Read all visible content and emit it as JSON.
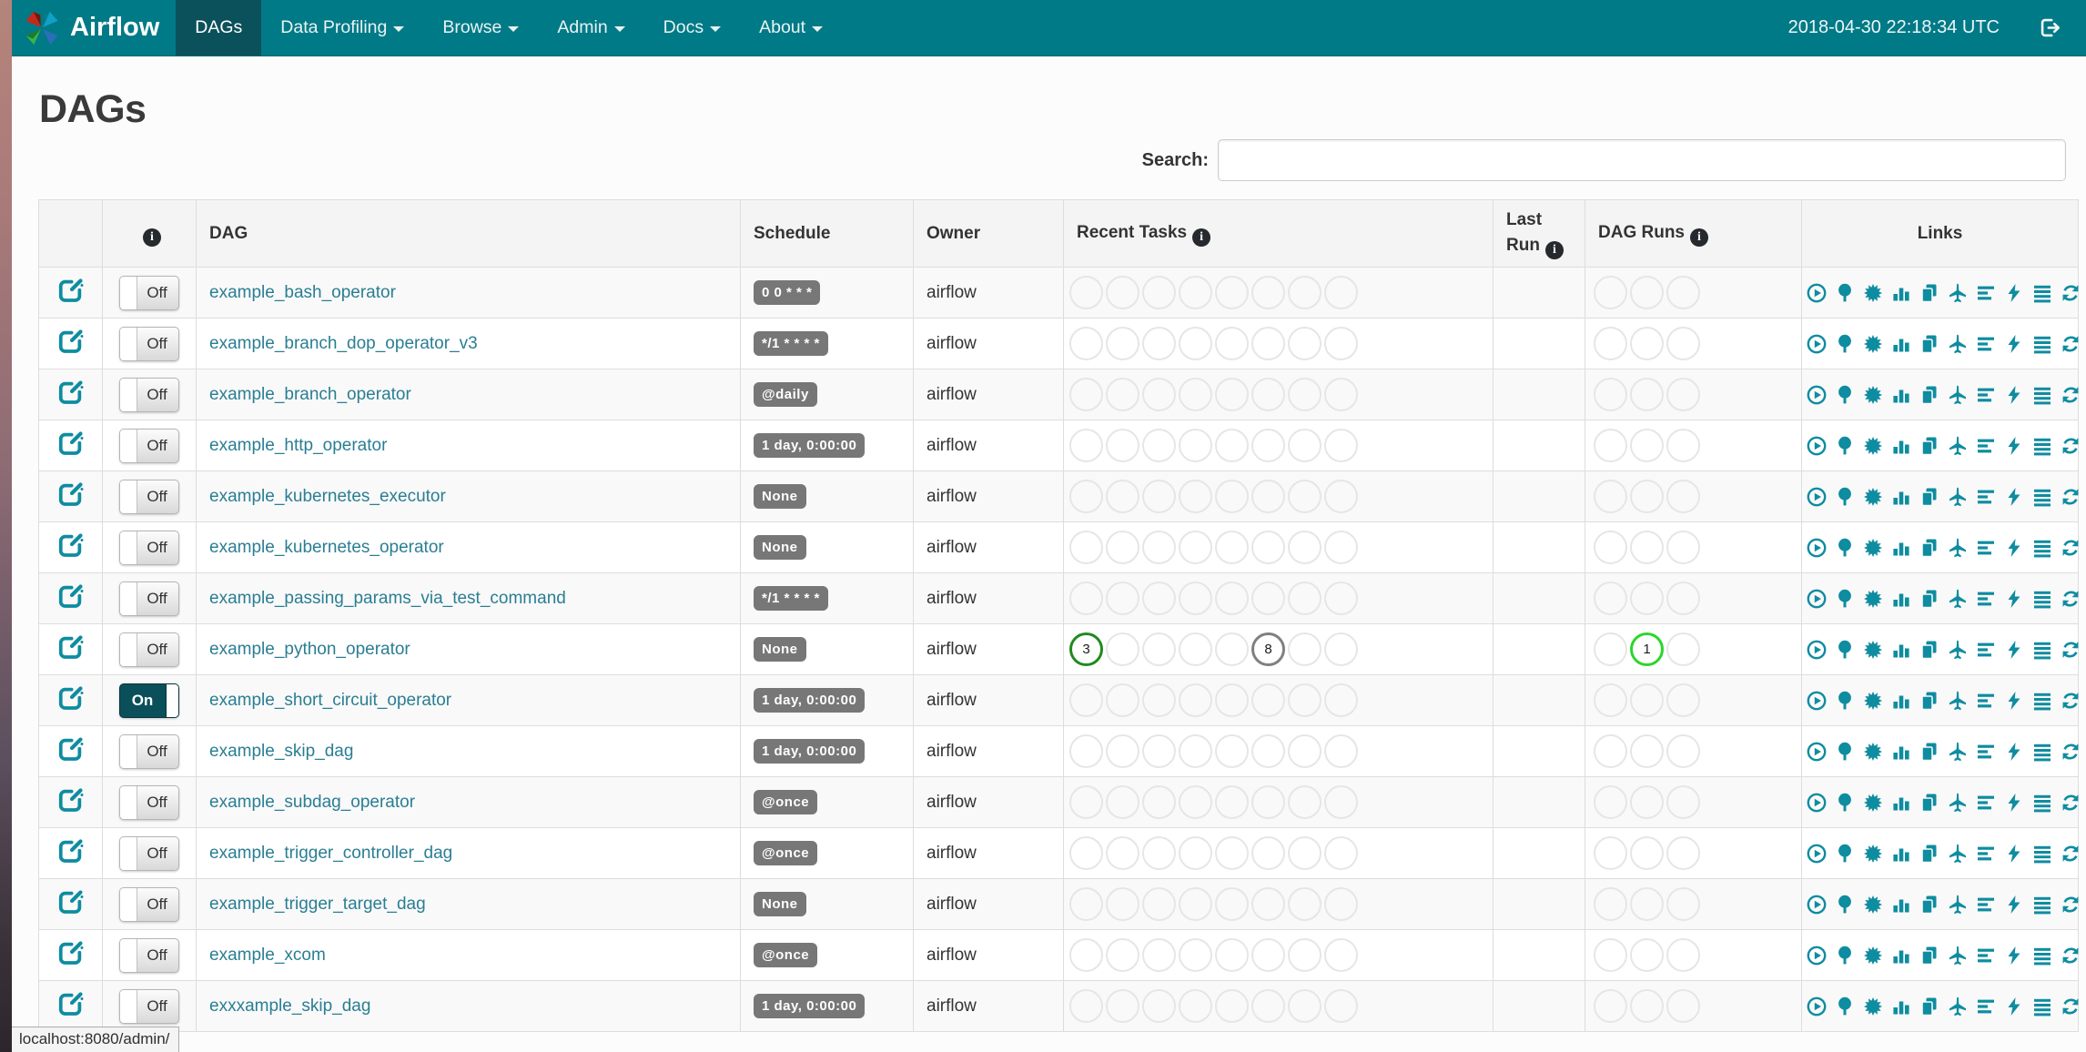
{
  "page": {
    "heading": "DAGs"
  },
  "navbar": {
    "brand": "Airflow",
    "items": [
      {
        "label": "DAGs",
        "active": true,
        "caret": false
      },
      {
        "label": "Data Profiling",
        "active": false,
        "caret": true
      },
      {
        "label": "Browse",
        "active": false,
        "caret": true
      },
      {
        "label": "Admin",
        "active": false,
        "caret": true
      },
      {
        "label": "Docs",
        "active": false,
        "caret": true
      },
      {
        "label": "About",
        "active": false,
        "caret": true
      }
    ],
    "clock": "2018-04-30 22:18:34 UTC"
  },
  "search": {
    "label": "Search:",
    "value": ""
  },
  "table": {
    "headers": {
      "edit": "",
      "dag": "DAG",
      "schedule": "Schedule",
      "owner": "Owner",
      "recent_tasks": "Recent Tasks",
      "last_run": "Last Run",
      "dag_runs": "DAG Runs",
      "links": "Links"
    },
    "recent_task_slots": 8,
    "dag_run_slots": 3,
    "link_actions": [
      {
        "name": "trigger-dag",
        "icon": "play-circle"
      },
      {
        "name": "tree-view",
        "icon": "tree"
      },
      {
        "name": "graph-view",
        "icon": "sunburst"
      },
      {
        "name": "task-duration",
        "icon": "bar-chart"
      },
      {
        "name": "task-tries",
        "icon": "copy"
      },
      {
        "name": "landing-times",
        "icon": "plane"
      },
      {
        "name": "gantt",
        "icon": "align-left"
      },
      {
        "name": "code",
        "icon": "bolt"
      },
      {
        "name": "logs",
        "icon": "menu-lines"
      },
      {
        "name": "refresh",
        "icon": "refresh"
      }
    ],
    "rows": [
      {
        "dag_id": "example_bash_operator",
        "toggle": "Off",
        "schedule": "0 0 * * *",
        "owner": "airflow",
        "recent_tasks": [],
        "last_run": "",
        "dag_runs": []
      },
      {
        "dag_id": "example_branch_dop_operator_v3",
        "toggle": "Off",
        "schedule": "*/1 * * * *",
        "owner": "airflow",
        "recent_tasks": [],
        "last_run": "",
        "dag_runs": []
      },
      {
        "dag_id": "example_branch_operator",
        "toggle": "Off",
        "schedule": "@daily",
        "owner": "airflow",
        "recent_tasks": [],
        "last_run": "",
        "dag_runs": []
      },
      {
        "dag_id": "example_http_operator",
        "toggle": "Off",
        "schedule": "1 day, 0:00:00",
        "owner": "airflow",
        "recent_tasks": [],
        "last_run": "",
        "dag_runs": []
      },
      {
        "dag_id": "example_kubernetes_executor",
        "toggle": "Off",
        "schedule": "None",
        "owner": "airflow",
        "recent_tasks": [],
        "last_run": "",
        "dag_runs": []
      },
      {
        "dag_id": "example_kubernetes_operator",
        "toggle": "Off",
        "schedule": "None",
        "owner": "airflow",
        "recent_tasks": [],
        "last_run": "",
        "dag_runs": []
      },
      {
        "dag_id": "example_passing_params_via_test_command",
        "toggle": "Off",
        "schedule": "*/1 * * * *",
        "owner": "airflow",
        "recent_tasks": [],
        "last_run": "",
        "dag_runs": []
      },
      {
        "dag_id": "example_python_operator",
        "toggle": "Off",
        "schedule": "None",
        "owner": "airflow",
        "recent_tasks": [
          {
            "slot": 1,
            "value": "3",
            "state_color": "#1F8A1F"
          },
          {
            "slot": 6,
            "value": "8",
            "state_color": "#808080"
          }
        ],
        "last_run": "",
        "dag_runs": [
          {
            "slot": 2,
            "value": "1",
            "state_color": "#2BD62B"
          }
        ]
      },
      {
        "dag_id": "example_short_circuit_operator",
        "toggle": "On",
        "schedule": "1 day, 0:00:00",
        "owner": "airflow",
        "recent_tasks": [],
        "last_run": "",
        "dag_runs": []
      },
      {
        "dag_id": "example_skip_dag",
        "toggle": "Off",
        "schedule": "1 day, 0:00:00",
        "owner": "airflow",
        "recent_tasks": [],
        "last_run": "",
        "dag_runs": []
      },
      {
        "dag_id": "example_subdag_operator",
        "toggle": "Off",
        "schedule": "@once",
        "owner": "airflow",
        "recent_tasks": [],
        "last_run": "",
        "dag_runs": []
      },
      {
        "dag_id": "example_trigger_controller_dag",
        "toggle": "Off",
        "schedule": "@once",
        "owner": "airflow",
        "recent_tasks": [],
        "last_run": "",
        "dag_runs": []
      },
      {
        "dag_id": "example_trigger_target_dag",
        "toggle": "Off",
        "schedule": "None",
        "owner": "airflow",
        "recent_tasks": [],
        "last_run": "",
        "dag_runs": []
      },
      {
        "dag_id": "example_xcom",
        "toggle": "Off",
        "schedule": "@once",
        "owner": "airflow",
        "recent_tasks": [],
        "last_run": "",
        "dag_runs": []
      },
      {
        "dag_id": "exxxample_skip_dag",
        "toggle": "Off",
        "schedule": "1 day, 0:00:00",
        "owner": "airflow",
        "recent_tasks": [],
        "last_run": "",
        "dag_runs": []
      }
    ]
  },
  "status_bar": {
    "url": "localhost:8080/admin/"
  },
  "colors": {
    "navbar": "#007A87",
    "navbar_active": "#0B515C",
    "accent_teal": "#0E8CA0",
    "dag_link": "#2A7E93",
    "badge_bg": "#777777",
    "toggle_on_bg": "#0B4F5A",
    "task_success_green": "#1F8A1F",
    "task_gray": "#808080",
    "run_running_lime": "#2BD62B",
    "empty_circle_border": "#E6E6E6"
  }
}
